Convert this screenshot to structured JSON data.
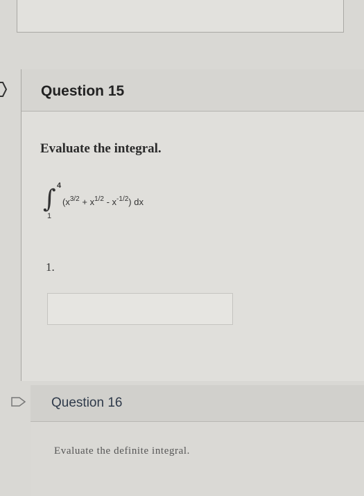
{
  "question15": {
    "title": "Question 15",
    "prompt": "Evaluate the integral.",
    "integral": {
      "upper": "4",
      "lower": "1",
      "t1": "(x",
      "e1": "3/2",
      "t2": " + x",
      "e2": "1/2",
      "t3": " - x",
      "e3": "-1/2",
      "t4": ") dx"
    },
    "item_number": "1.",
    "answer_value": ""
  },
  "question16": {
    "title": "Question 16",
    "prompt": "Evaluate the definite integral."
  },
  "colors": {
    "page_bg": "#d9d8d4",
    "header_bg": "#d6d5d1",
    "title_text": "#222222"
  },
  "icons": [
    "flag-icon"
  ]
}
